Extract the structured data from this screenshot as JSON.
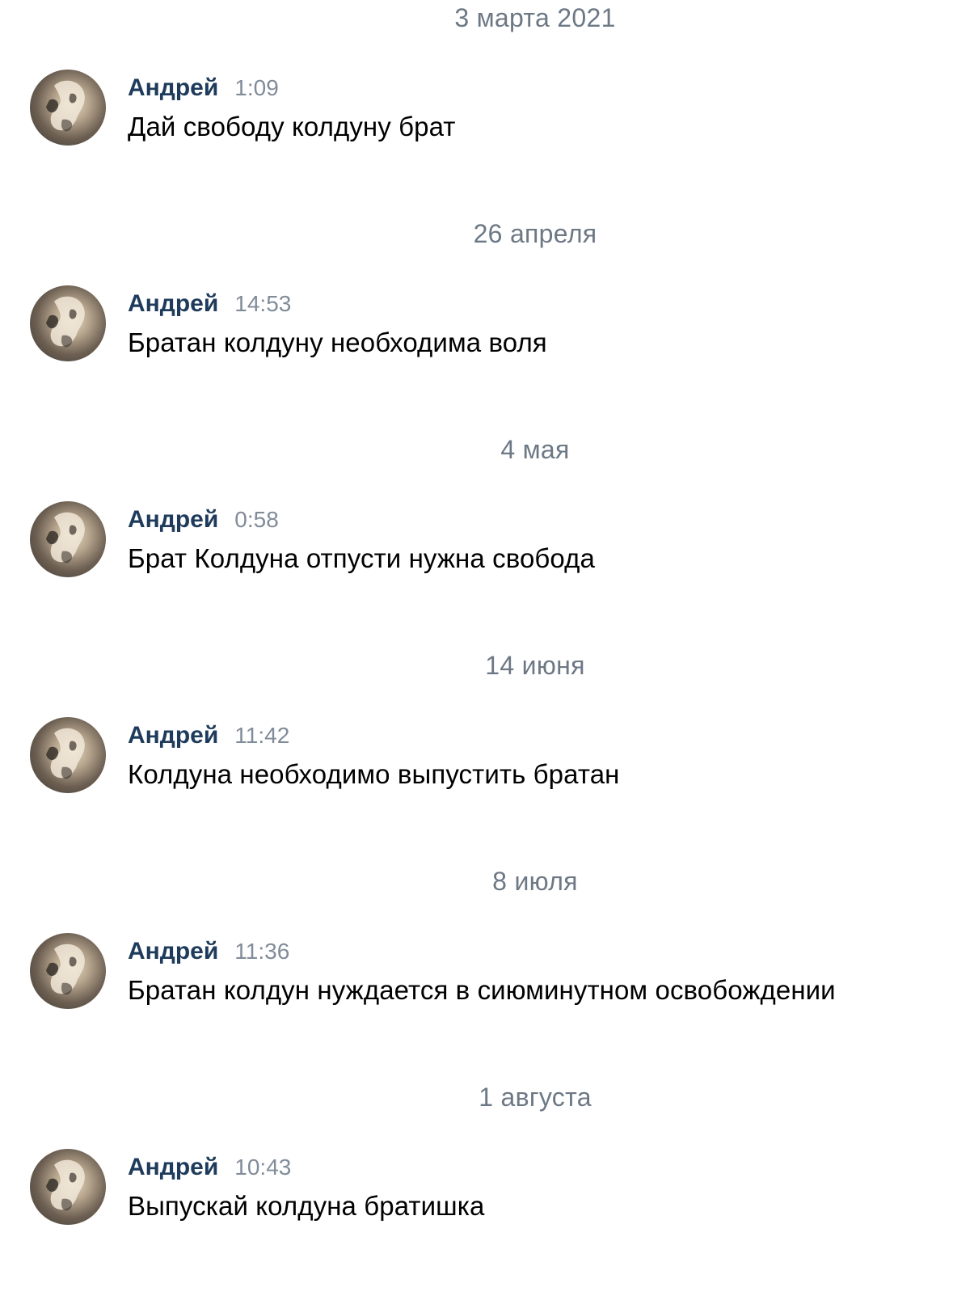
{
  "messages": [
    {
      "date": "3 марта 2021",
      "author": "Андрей",
      "time": "1:09",
      "text": "Дай свободу колдуну брат"
    },
    {
      "date": "26 апреля",
      "author": "Андрей",
      "time": "14:53",
      "text": "Братан колдуну необходима воля"
    },
    {
      "date": "4 мая",
      "author": "Андрей",
      "time": "0:58",
      "text": "Брат Колдуна отпусти нужна свобода"
    },
    {
      "date": "14 июня",
      "author": "Андрей",
      "time": "11:42",
      "text": "Колдуна необходимо выпустить братан"
    },
    {
      "date": "8 июля",
      "author": "Андрей",
      "time": "11:36",
      "text": "Братан колдун нуждается в сиюминутном освобождении"
    },
    {
      "date": "1 августа",
      "author": "Андрей",
      "time": "10:43",
      "text": "Выпускай колдуна братишка"
    }
  ]
}
